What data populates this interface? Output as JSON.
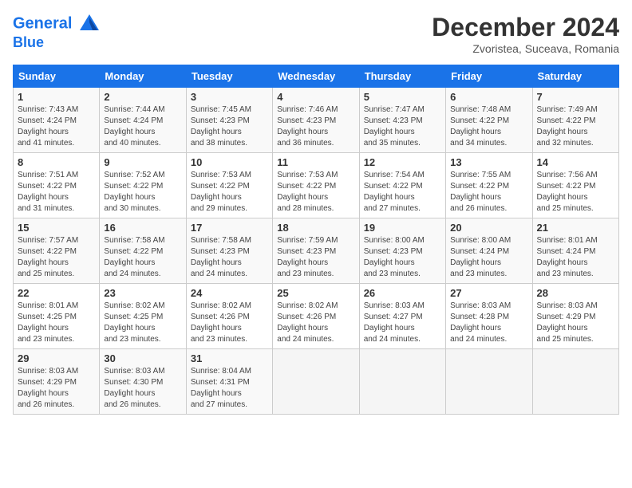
{
  "header": {
    "logo_line1": "General",
    "logo_line2": "Blue",
    "month_title": "December 2024",
    "subtitle": "Zvoristea, Suceava, Romania"
  },
  "weekdays": [
    "Sunday",
    "Monday",
    "Tuesday",
    "Wednesday",
    "Thursday",
    "Friday",
    "Saturday"
  ],
  "weeks": [
    [
      {
        "day": "1",
        "sunrise": "7:43 AM",
        "sunset": "4:24 PM",
        "daylight": "8 hours and 41 minutes."
      },
      {
        "day": "2",
        "sunrise": "7:44 AM",
        "sunset": "4:24 PM",
        "daylight": "8 hours and 40 minutes."
      },
      {
        "day": "3",
        "sunrise": "7:45 AM",
        "sunset": "4:23 PM",
        "daylight": "8 hours and 38 minutes."
      },
      {
        "day": "4",
        "sunrise": "7:46 AM",
        "sunset": "4:23 PM",
        "daylight": "8 hours and 36 minutes."
      },
      {
        "day": "5",
        "sunrise": "7:47 AM",
        "sunset": "4:23 PM",
        "daylight": "8 hours and 35 minutes."
      },
      {
        "day": "6",
        "sunrise": "7:48 AM",
        "sunset": "4:22 PM",
        "daylight": "8 hours and 34 minutes."
      },
      {
        "day": "7",
        "sunrise": "7:49 AM",
        "sunset": "4:22 PM",
        "daylight": "8 hours and 32 minutes."
      }
    ],
    [
      {
        "day": "8",
        "sunrise": "7:51 AM",
        "sunset": "4:22 PM",
        "daylight": "8 hours and 31 minutes."
      },
      {
        "day": "9",
        "sunrise": "7:52 AM",
        "sunset": "4:22 PM",
        "daylight": "8 hours and 30 minutes."
      },
      {
        "day": "10",
        "sunrise": "7:53 AM",
        "sunset": "4:22 PM",
        "daylight": "8 hours and 29 minutes."
      },
      {
        "day": "11",
        "sunrise": "7:53 AM",
        "sunset": "4:22 PM",
        "daylight": "8 hours and 28 minutes."
      },
      {
        "day": "12",
        "sunrise": "7:54 AM",
        "sunset": "4:22 PM",
        "daylight": "8 hours and 27 minutes."
      },
      {
        "day": "13",
        "sunrise": "7:55 AM",
        "sunset": "4:22 PM",
        "daylight": "8 hours and 26 minutes."
      },
      {
        "day": "14",
        "sunrise": "7:56 AM",
        "sunset": "4:22 PM",
        "daylight": "8 hours and 25 minutes."
      }
    ],
    [
      {
        "day": "15",
        "sunrise": "7:57 AM",
        "sunset": "4:22 PM",
        "daylight": "8 hours and 25 minutes."
      },
      {
        "day": "16",
        "sunrise": "7:58 AM",
        "sunset": "4:22 PM",
        "daylight": "8 hours and 24 minutes."
      },
      {
        "day": "17",
        "sunrise": "7:58 AM",
        "sunset": "4:23 PM",
        "daylight": "8 hours and 24 minutes."
      },
      {
        "day": "18",
        "sunrise": "7:59 AM",
        "sunset": "4:23 PM",
        "daylight": "8 hours and 23 minutes."
      },
      {
        "day": "19",
        "sunrise": "8:00 AM",
        "sunset": "4:23 PM",
        "daylight": "8 hours and 23 minutes."
      },
      {
        "day": "20",
        "sunrise": "8:00 AM",
        "sunset": "4:24 PM",
        "daylight": "8 hours and 23 minutes."
      },
      {
        "day": "21",
        "sunrise": "8:01 AM",
        "sunset": "4:24 PM",
        "daylight": "8 hours and 23 minutes."
      }
    ],
    [
      {
        "day": "22",
        "sunrise": "8:01 AM",
        "sunset": "4:25 PM",
        "daylight": "8 hours and 23 minutes."
      },
      {
        "day": "23",
        "sunrise": "8:02 AM",
        "sunset": "4:25 PM",
        "daylight": "8 hours and 23 minutes."
      },
      {
        "day": "24",
        "sunrise": "8:02 AM",
        "sunset": "4:26 PM",
        "daylight": "8 hours and 23 minutes."
      },
      {
        "day": "25",
        "sunrise": "8:02 AM",
        "sunset": "4:26 PM",
        "daylight": "8 hours and 24 minutes."
      },
      {
        "day": "26",
        "sunrise": "8:03 AM",
        "sunset": "4:27 PM",
        "daylight": "8 hours and 24 minutes."
      },
      {
        "day": "27",
        "sunrise": "8:03 AM",
        "sunset": "4:28 PM",
        "daylight": "8 hours and 24 minutes."
      },
      {
        "day": "28",
        "sunrise": "8:03 AM",
        "sunset": "4:29 PM",
        "daylight": "8 hours and 25 minutes."
      }
    ],
    [
      {
        "day": "29",
        "sunrise": "8:03 AM",
        "sunset": "4:29 PM",
        "daylight": "8 hours and 26 minutes."
      },
      {
        "day": "30",
        "sunrise": "8:03 AM",
        "sunset": "4:30 PM",
        "daylight": "8 hours and 26 minutes."
      },
      {
        "day": "31",
        "sunrise": "8:04 AM",
        "sunset": "4:31 PM",
        "daylight": "8 hours and 27 minutes."
      },
      null,
      null,
      null,
      null
    ]
  ]
}
